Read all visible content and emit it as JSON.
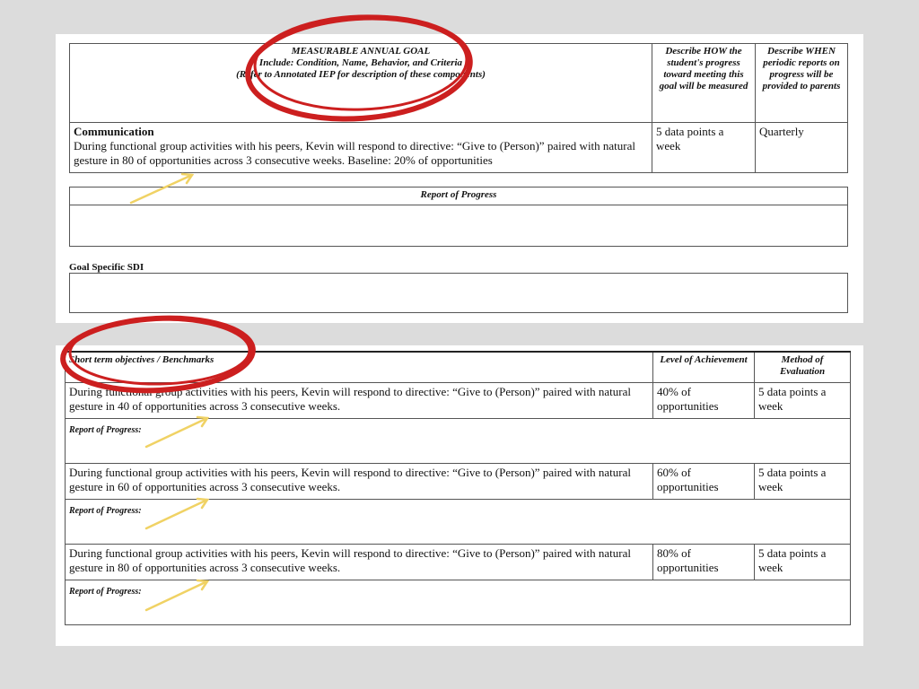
{
  "goal_table": {
    "header_title": "MEASURABLE ANNUAL GOAL",
    "header_include": "Include: Condition, Name, Behavior, and Criteria",
    "header_refer": "(Refer to Annotated IEP for description of these components)",
    "col_how": "Describe HOW the student's progress toward meeting this goal will be measured",
    "col_when": "Describe WHEN periodic reports on progress will be provided to parents",
    "area": "Communication",
    "goal_text": "During functional group activities with his peers, Kevin will respond to directive: “Give to (Person)” paired with natural gesture in 80 of opportunities across 3 consecutive weeks. Baseline: 20% of opportunities",
    "how_value": "5 data points a week",
    "when_value": "Quarterly"
  },
  "report_of_progress_title": "Report of Progress",
  "goal_specific_sdi_label": "Goal Specific SDI",
  "objectives_table": {
    "col_objectives": "Short term objectives / Benchmarks",
    "col_level": "Level of Achievement",
    "col_method": "Method of Evaluation",
    "report_label": "Report of Progress:",
    "rows": [
      {
        "text": "During functional group activities with his peers, Kevin will respond to directive: “Give to (Person)” paired with natural gesture in 40 of opportunities across 3 consecutive weeks.",
        "level": "40% of opportunities",
        "method": "5 data points a week"
      },
      {
        "text": "During functional group activities with his peers, Kevin will respond to directive: “Give to (Person)” paired with natural gesture in 60 of opportunities across 3 consecutive weeks.",
        "level": "60% of opportunities",
        "method": "5 data points a week"
      },
      {
        "text": "During functional group activities with his peers, Kevin will respond to directive: “Give to (Person)” paired with natural gesture in 80 of opportunities across 3 consecutive weeks.",
        "level": "80% of opportunities",
        "method": "5 data points a week"
      }
    ]
  },
  "annotation_colors": {
    "circle": "#cc1f1f",
    "arrow": "#f0d264"
  }
}
